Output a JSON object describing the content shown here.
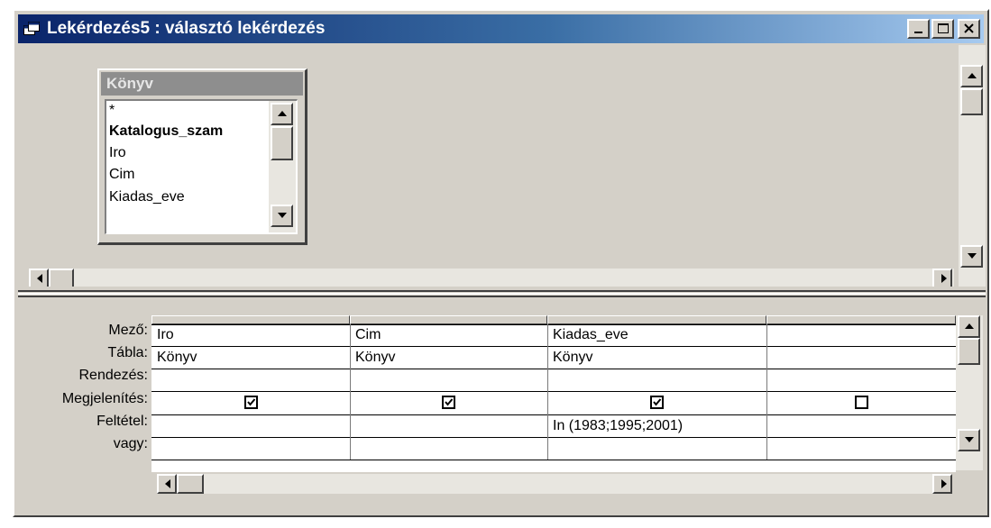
{
  "window": {
    "title": "Lekérdezés5 : választó lekérdezés",
    "buttons": {
      "minimize": "minimize-icon",
      "maximize": "maximize-icon",
      "close": "close-icon"
    }
  },
  "table_box": {
    "title": "Könyv",
    "fields": [
      "*",
      "Katalogus_szam",
      "Iro",
      "Cim",
      "Kiadas_eve"
    ],
    "primary_key": "Katalogus_szam"
  },
  "grid": {
    "row_labels": [
      "Mező:",
      "Tábla:",
      "Rendezés:",
      "Megjelenítés:",
      "Feltétel:",
      "vagy:"
    ],
    "columns": [
      {
        "field": "Iro",
        "table": "Könyv",
        "sort": "",
        "show": true,
        "criteria": "",
        "or": ""
      },
      {
        "field": "Cim",
        "table": "Könyv",
        "sort": "",
        "show": true,
        "criteria": "",
        "or": ""
      },
      {
        "field": "Kiadas_eve",
        "table": "Könyv",
        "sort": "",
        "show": true,
        "criteria": "In (1983;1995;2001)",
        "or": ""
      },
      {
        "field": "",
        "table": "",
        "sort": "",
        "show": false,
        "criteria": "",
        "or": ""
      }
    ]
  },
  "colors": {
    "title_start": "#0a246a",
    "title_end": "#a6caf0",
    "face": "#d4d0c8"
  }
}
